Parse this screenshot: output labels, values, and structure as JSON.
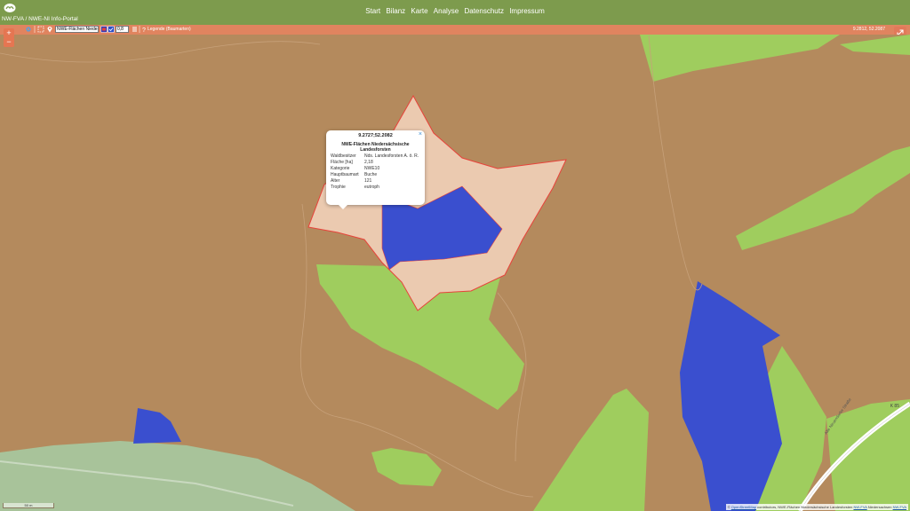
{
  "header": {
    "site_title": "NW-FVA / NWE-NI Info-Portal",
    "nav": [
      "Start",
      "Bilanz",
      "Karte",
      "Analyse",
      "Datenschutz",
      "Impressum"
    ]
  },
  "toolbar": {
    "layer_select_value": "NWE-Flächen Nieders",
    "opacity_value": "0,8",
    "legend_label": "Legende (Baumarten)",
    "cursor_coordinates": "9.2812, 52.2087"
  },
  "map": {
    "zoom_in": "+",
    "zoom_out": "−",
    "road_label": "Alte Neuendorfer Straße",
    "road_number": "K 85",
    "scale": "50 m",
    "colors": {
      "forest_background": "#b48a5d",
      "meadow": "#9fcd5e",
      "water_blue_area": "#3a4fcf",
      "selected_polygon": "#ebcab0",
      "polygon_border": "#e8423a"
    }
  },
  "popup": {
    "coordinates": "9.2727;52.2082",
    "title": "NWE-Flächen Niedersächsische Landesforsten",
    "close": "×",
    "rows": [
      {
        "key": "Waldbesitzer",
        "value": "Nds. Landesforsten A. ö. R."
      },
      {
        "key": "Fläche [ha]",
        "value": "2,18"
      },
      {
        "key": "Kategorie",
        "value": "NWE10"
      },
      {
        "key": "Hauptbaumart",
        "value": "Buche"
      },
      {
        "key": "Alter",
        "value": "121"
      },
      {
        "key": "Trophie",
        "value": "eutroph"
      }
    ]
  },
  "attribution": {
    "prefix": "©",
    "osm_link": "OpenStreetMap",
    "text1": "contributors, NWE-Flächen Niedersächsische Landesforsten",
    "link2": "NW-FVA",
    "text2": "Niedersachsen",
    "link3": "NW-FVA"
  }
}
